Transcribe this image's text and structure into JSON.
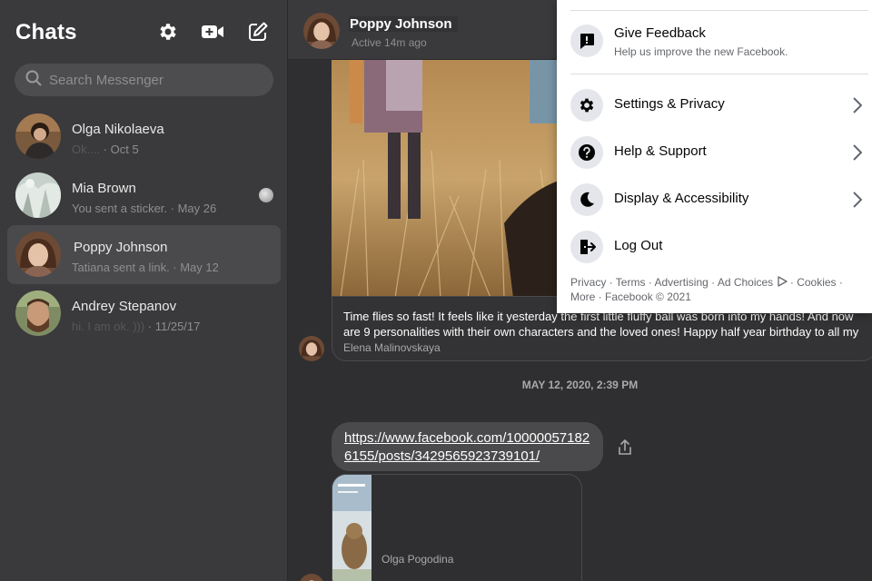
{
  "sidebar": {
    "title": "Chats",
    "search_placeholder": "Search Messenger",
    "chats": [
      {
        "name": "Olga Nikolaeva",
        "preview_blur": "Ok....",
        "preview": " · Oct 5"
      },
      {
        "name": "Mia Brown",
        "preview": "You sent a sticker. · May 26"
      },
      {
        "name": "Poppy Johnson",
        "preview": "Tatiana sent a link. · May 12"
      },
      {
        "name": "Andrey Stepanov",
        "preview_blur": "hi. I am ok. )))",
        "preview": " · 11/25/17"
      }
    ]
  },
  "conversation": {
    "contact_name": "Poppy Johnson",
    "status": "Active 14m ago",
    "caption_line1": "Time flies so fast! It feels like it yesterday the first little fluffy ball was born into my hands! And now",
    "caption_line2": "are 9 personalities with their own characters and the loved ones! Happy half year birthday to all my",
    "caption_source": "Elena Malinovskaya",
    "date_separator": "MAY 12, 2020, 2:39 PM",
    "link_text": "https://www.facebook.com/100000571826155/posts/3429565923739101/",
    "link_card_author": "Olga Pogodina"
  },
  "menu": {
    "feedback": {
      "label": "Give Feedback",
      "sub": "Help us improve the new Facebook."
    },
    "items": [
      {
        "label": "Settings & Privacy"
      },
      {
        "label": "Help & Support"
      },
      {
        "label": "Display & Accessibility"
      },
      {
        "label": "Log Out"
      }
    ],
    "footer_line1": "Privacy · Terms · Advertising · Ad Choices",
    "footer_cookies": " · Cookies ·",
    "footer_line2": "More · Facebook © 2021"
  },
  "colors": {
    "sidebar_bg": "#3a3a3c",
    "conversation_bg": "#2f2f31",
    "menu_bg": "#ffffff",
    "active_chat_bg": "#4a4a4c"
  },
  "icons": [
    "gear-icon",
    "video-plus-icon",
    "compose-icon",
    "search-icon",
    "share-icon",
    "feedback-icon",
    "settings-icon",
    "help-icon",
    "moon-icon",
    "logout-icon",
    "chevron-right-icon",
    "ad-choices-icon"
  ]
}
